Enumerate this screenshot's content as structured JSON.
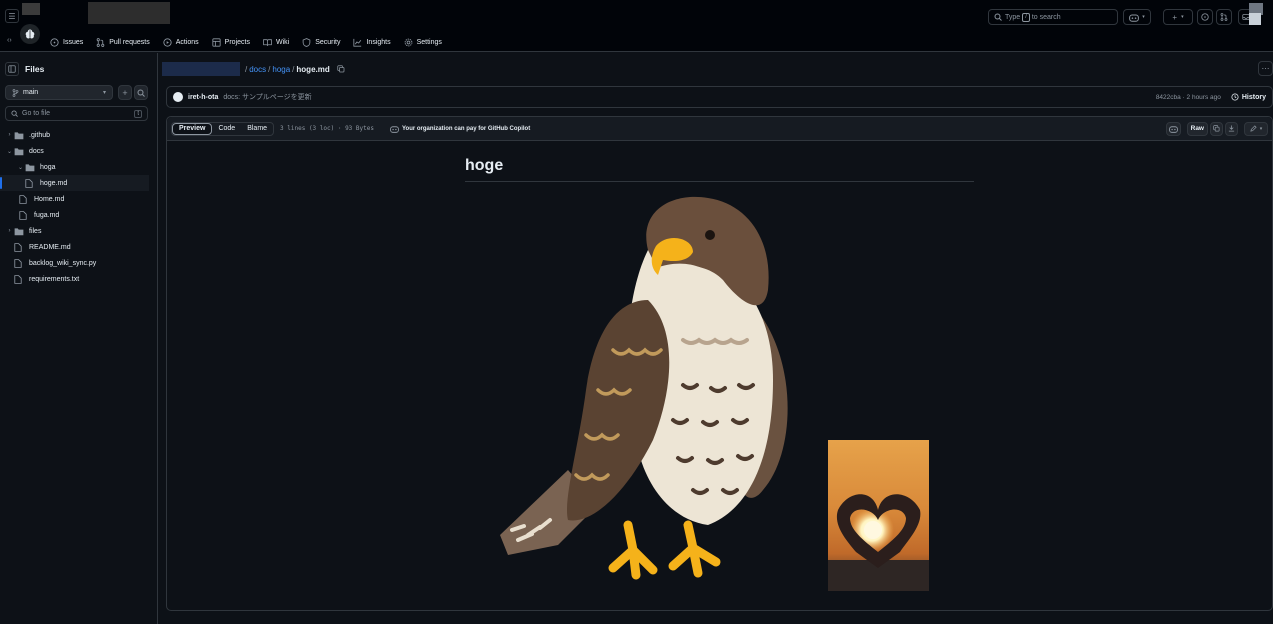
{
  "header": {
    "search_placeholder": "Type",
    "search_key": "/",
    "search_suffix": "to search"
  },
  "nav": {
    "tabs": [
      {
        "label": "Issues",
        "icon": "issue-icon"
      },
      {
        "label": "Pull requests",
        "icon": "pull-request-icon"
      },
      {
        "label": "Actions",
        "icon": "play-icon"
      },
      {
        "label": "Projects",
        "icon": "table-icon"
      },
      {
        "label": "Wiki",
        "icon": "book-icon"
      },
      {
        "label": "Security",
        "icon": "shield-icon"
      },
      {
        "label": "Insights",
        "icon": "graph-icon"
      },
      {
        "label": "Settings",
        "icon": "gear-icon"
      }
    ]
  },
  "sidebar": {
    "title": "Files",
    "branch": "main",
    "goto_placeholder": "Go to file",
    "goto_key": "t",
    "tree": [
      {
        "label": ".github",
        "type": "folder",
        "expanded": false
      },
      {
        "label": "docs",
        "type": "folder",
        "expanded": true
      },
      {
        "label": "hoga",
        "type": "folder",
        "expanded": true
      },
      {
        "label": "hoge.md",
        "type": "file",
        "active": true
      },
      {
        "label": "Home.md",
        "type": "file"
      },
      {
        "label": "fuga.md",
        "type": "file"
      },
      {
        "label": "files",
        "type": "folder",
        "expanded": false
      },
      {
        "label": "README.md",
        "type": "file"
      },
      {
        "label": "backlog_wiki_sync.py",
        "type": "file"
      },
      {
        "label": "requirements.txt",
        "type": "file"
      }
    ]
  },
  "breadcrumb": {
    "parts": [
      "docs",
      "hoga"
    ],
    "current": "hoge.md"
  },
  "commit": {
    "author": "iret-h-ota",
    "message": "docs: サンプルページを更新",
    "meta": "8422cba · 2 hours ago",
    "history_label": "History"
  },
  "viewer": {
    "tabs": [
      "Preview",
      "Code",
      "Blame"
    ],
    "info": "3 lines (3 loc) · 93 Bytes",
    "copilot": "Your organization can pay for GitHub Copilot",
    "raw_label": "Raw"
  },
  "markdown": {
    "heading": "hoge"
  },
  "colors": {
    "accent": "#4493f8",
    "active_bar": "#1f6feb",
    "bg": "#0d1117"
  }
}
